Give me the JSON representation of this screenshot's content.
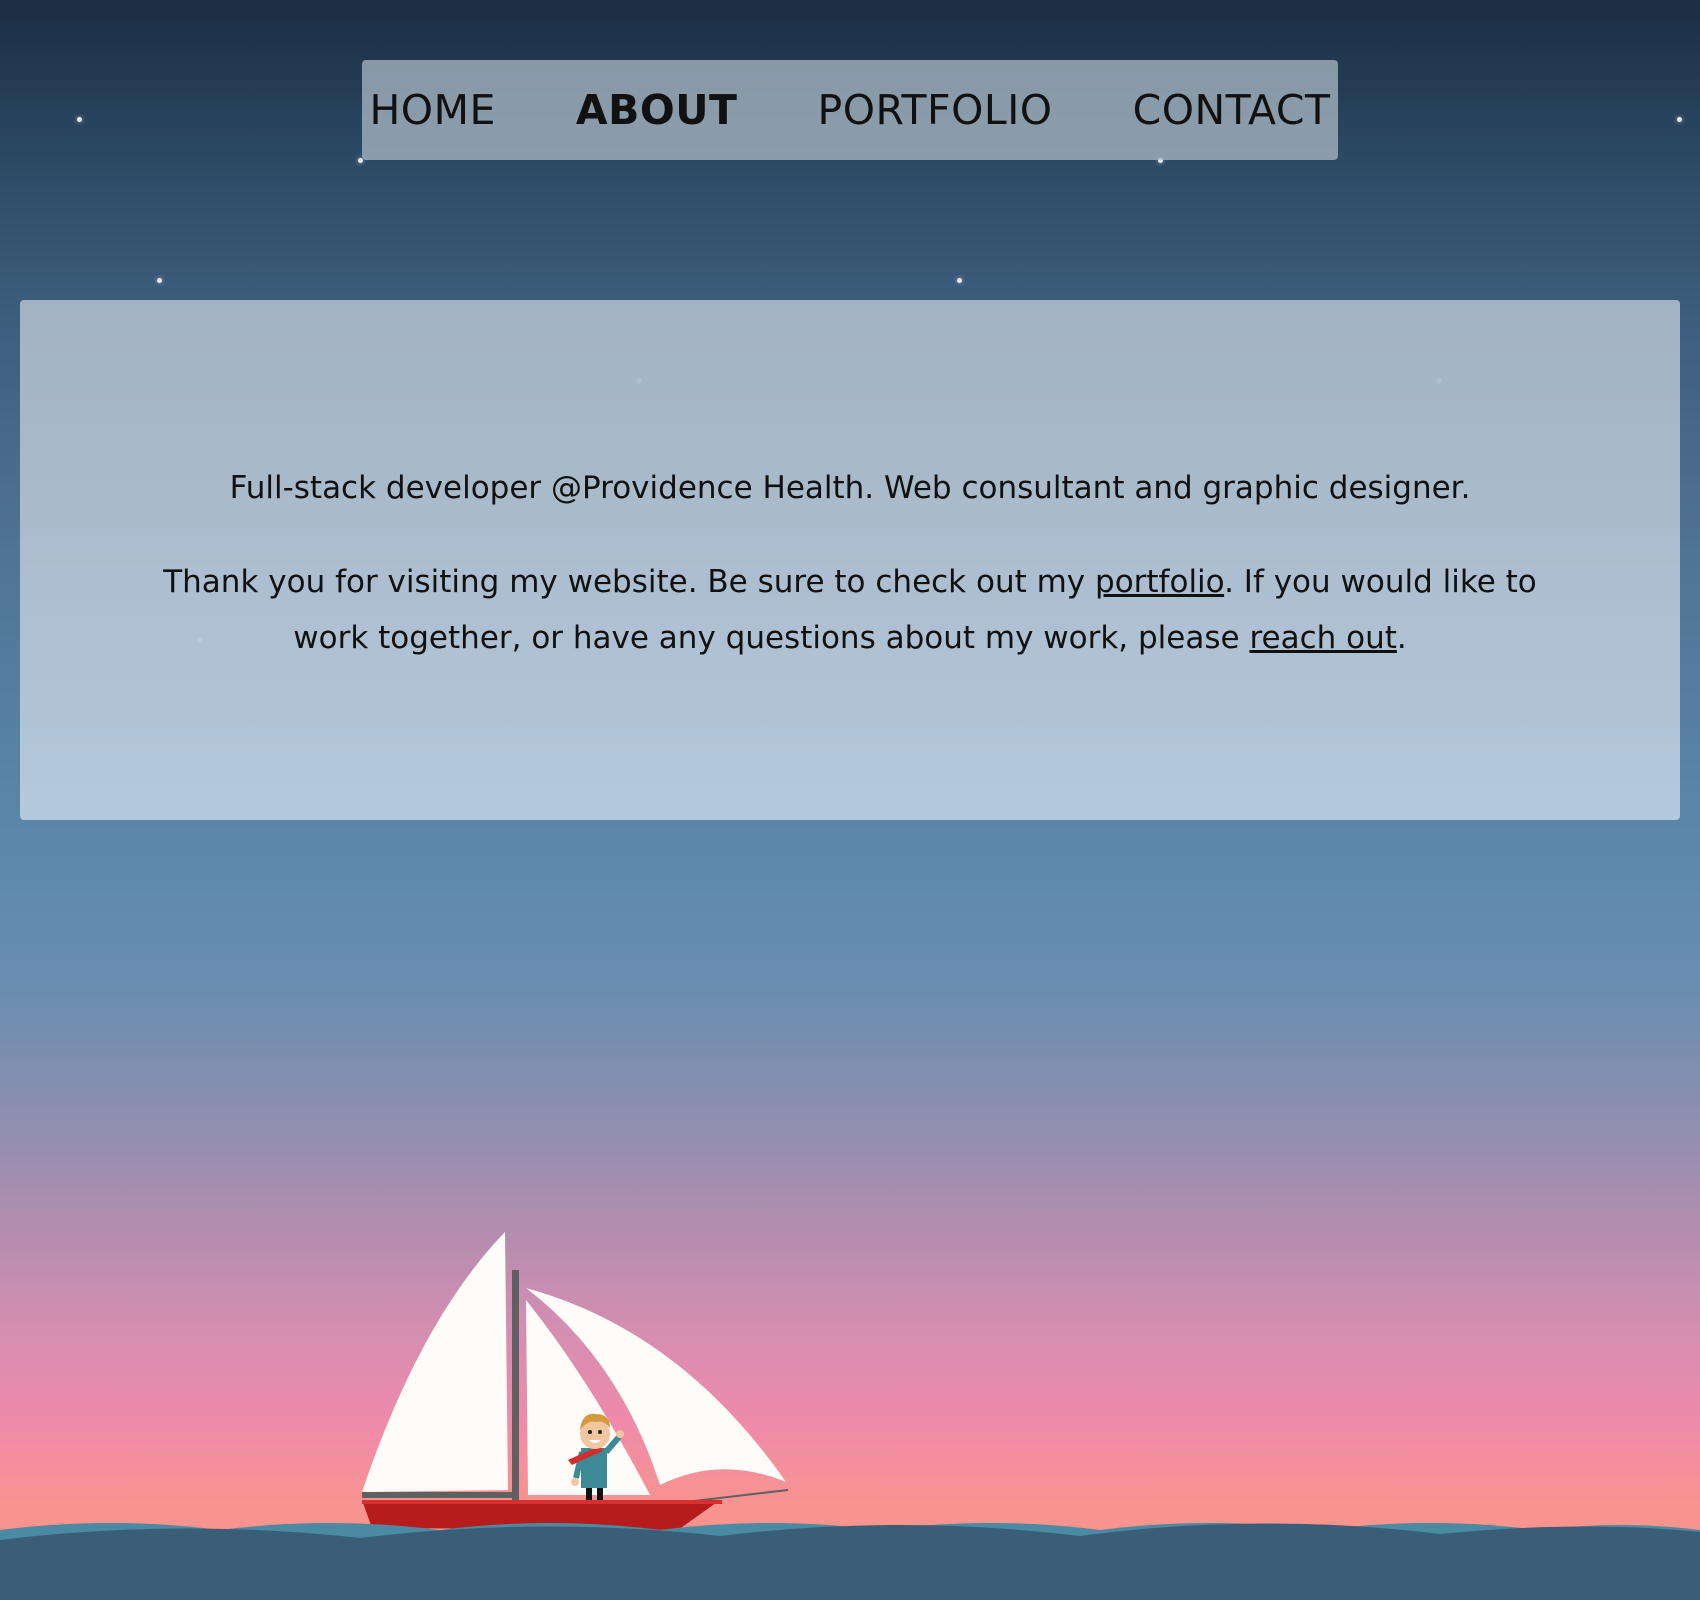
{
  "nav": {
    "items": [
      {
        "label": "HOME",
        "active": false
      },
      {
        "label": "ABOUT",
        "active": true
      },
      {
        "label": "PORTFOLIO",
        "active": false
      },
      {
        "label": "CONTACT",
        "active": false
      }
    ]
  },
  "about": {
    "line1": "Full-stack developer @Providence Health. Web consultant and graphic designer.",
    "line2_before": "Thank you for visiting my website. Be sure to check out my ",
    "portfolio_link": "portfolio",
    "line2_middle": ". If you would like to work together, or have any questions about my work, please ",
    "reach_out_link": "reach out",
    "line2_after": "."
  },
  "colors": {
    "hull": "#b71c1c",
    "sail": "#fdfcf8",
    "sea": "#3a5e78",
    "sea_highlight": "#4a8aa2"
  },
  "icons": [
    "sailboat-illustration",
    "sailor-figure",
    "star-dot"
  ]
}
